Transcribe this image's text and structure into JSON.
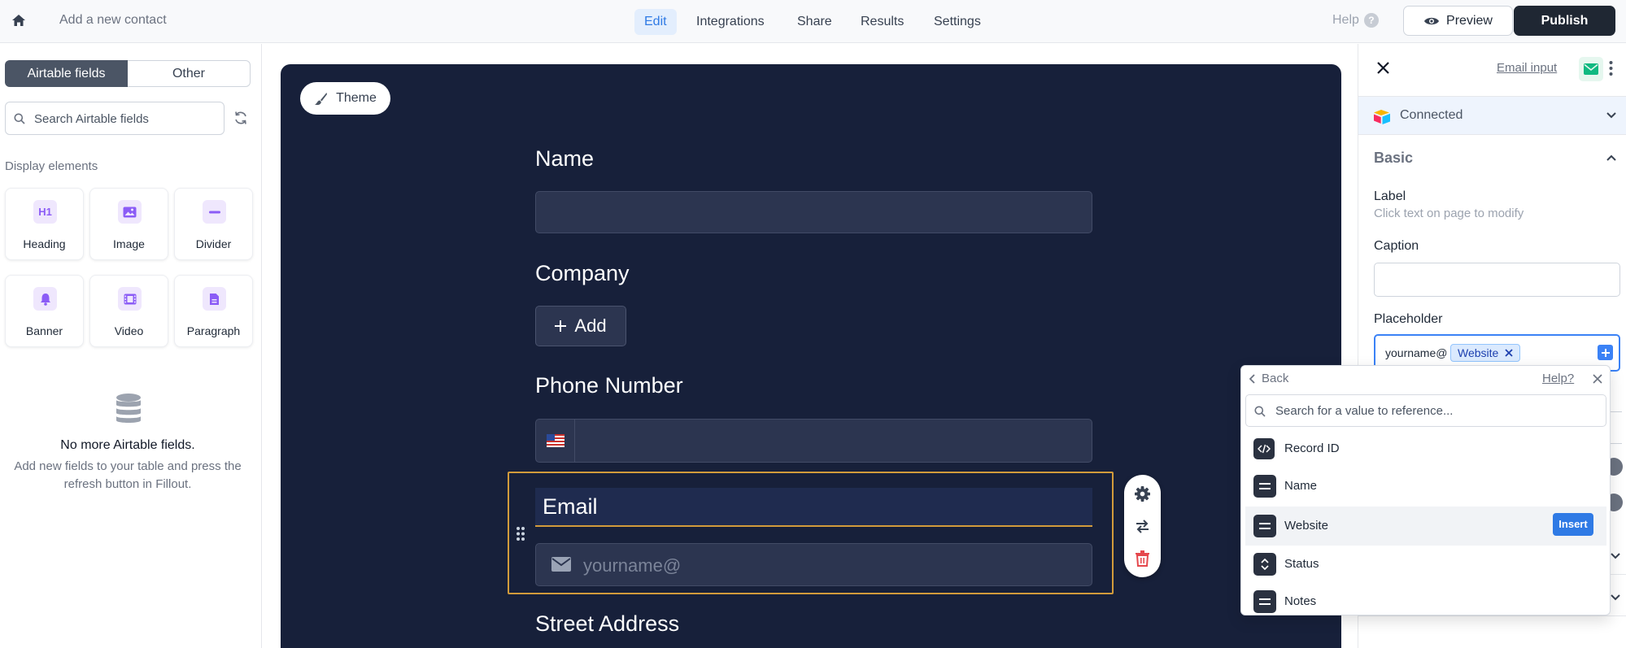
{
  "topbar": {
    "page_title": "Add a new contact",
    "nav": [
      {
        "label": "Edit",
        "active": true
      },
      {
        "label": "Integrations",
        "active": false
      },
      {
        "label": "Share",
        "active": false
      },
      {
        "label": "Results",
        "active": false
      },
      {
        "label": "Settings",
        "active": false
      }
    ],
    "help_label": "Help",
    "preview_label": "Preview",
    "publish_label": "Publish"
  },
  "left": {
    "tabs": [
      {
        "label": "Airtable fields",
        "active": true
      },
      {
        "label": "Other",
        "active": false
      }
    ],
    "search_placeholder": "Search Airtable fields",
    "section_title": "Display elements",
    "elements": [
      {
        "label": "Heading",
        "icon": "heading-icon"
      },
      {
        "label": "Image",
        "icon": "image-icon"
      },
      {
        "label": "Divider",
        "icon": "divider-icon"
      },
      {
        "label": "Banner",
        "icon": "bell-icon"
      },
      {
        "label": "Video",
        "icon": "video-icon"
      },
      {
        "label": "Paragraph",
        "icon": "document-icon"
      }
    ],
    "empty_title": "No more Airtable fields.",
    "empty_desc": "Add new fields to your table and press the refresh button in Fillout."
  },
  "canvas": {
    "theme_label": "Theme",
    "fields": {
      "name_label": "Name",
      "company_label": "Company",
      "add_label": "Add",
      "phone_label": "Phone Number",
      "email_label": "Email",
      "email_placeholder": "yourname@",
      "street_label": "Street Address"
    }
  },
  "right": {
    "field_type": "Email input",
    "connection": "Connected",
    "section": "Basic",
    "label_title": "Label",
    "label_hint": "Click text on page to modify",
    "caption_title": "Caption",
    "placeholder_title": "Placeholder",
    "placeholder_prefix": "yourname@",
    "placeholder_token": "Website"
  },
  "popup": {
    "back_label": "Back",
    "help_label": "Help?",
    "search_placeholder": "Search for a value to reference...",
    "items": [
      {
        "label": "Record ID",
        "icon": "code-icon"
      },
      {
        "label": "Name",
        "icon": "text-field-icon"
      },
      {
        "label": "Website",
        "icon": "text-field-icon",
        "hovered": true
      },
      {
        "label": "Status",
        "icon": "select-icon"
      },
      {
        "label": "Notes",
        "icon": "text-field-icon"
      }
    ],
    "insert_label": "Insert"
  },
  "colors": {
    "accent": "#2f7ae5",
    "canvas_bg": "#17203a",
    "selection_border": "#d29b3b",
    "publish_bg": "#1f2733",
    "purple_icon": "#8b5cf6",
    "delete_red": "#e5484d"
  }
}
